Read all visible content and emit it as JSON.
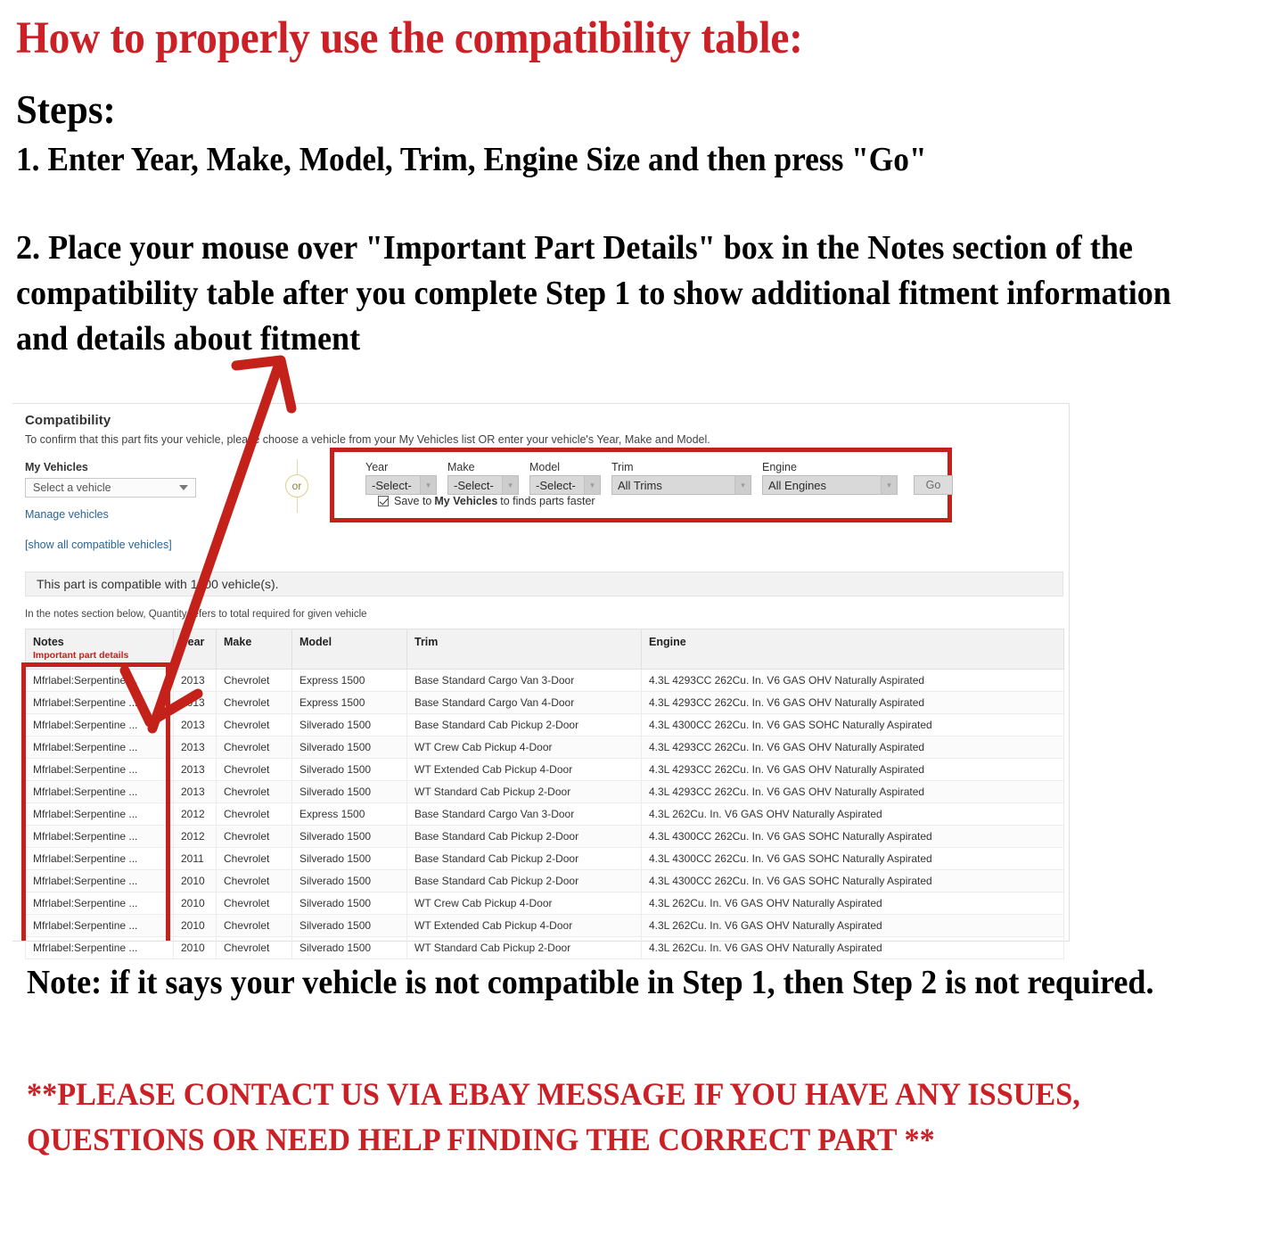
{
  "instructions": {
    "headline": "How to properly use the compatibility table:",
    "steps_label": "Steps:",
    "step1": "1. Enter Year, Make, Model, Trim, Engine Size and then press \"Go\"",
    "step2": "2. Place your mouse over \"Important Part Details\" box in the Notes section of the compatibility table after you complete Step 1 to show additional fitment information and details about fitment",
    "note": "Note: if it says your vehicle is not compatible in Step 1, then Step 2 is not required.",
    "contact": "**PLEASE CONTACT US VIA EBAY MESSAGE IF YOU HAVE ANY ISSUES, QUESTIONS OR NEED HELP FINDING THE CORRECT PART **"
  },
  "colors": {
    "accent_red": "#CC2027",
    "highlight_red": "#C5211B",
    "link_blue": "#2a6496",
    "header_gray": "#f2f2f2"
  },
  "compatibility": {
    "title": "Compatibility",
    "subtitle": "To confirm that this part fits your vehicle, please choose a vehicle from your My Vehicles list OR enter your vehicle's Year, Make and Model.",
    "my_vehicles_label": "My Vehicles",
    "my_vehicles_value": "Select a vehicle",
    "manage_vehicles_link": "Manage vehicles",
    "show_all_link": "[show all compatible vehicles]",
    "or_text": "or",
    "banner": "This part is compatible with 1000 vehicle(s).",
    "qty_note": "In the notes section below, Quantity refers to total required for given vehicle",
    "save_prefix": "Save to",
    "save_bold": "My Vehicles",
    "save_suffix": "to finds parts faster",
    "go_label": "Go",
    "fields": [
      {
        "label": "Year",
        "value": "-Select-",
        "size": "small"
      },
      {
        "label": "Make",
        "value": "-Select-",
        "size": "small"
      },
      {
        "label": "Model",
        "value": "-Select-",
        "size": "small"
      },
      {
        "label": "Trim",
        "value": "All Trims",
        "size": "med"
      },
      {
        "label": "Engine",
        "value": "All Engines",
        "size": "large"
      }
    ]
  },
  "table": {
    "headers": [
      "Notes",
      "Year",
      "Make",
      "Model",
      "Trim",
      "Engine"
    ],
    "notes_sub": "Important part details",
    "rows": [
      [
        "Mfrlabel:Serpentine ...",
        "2013",
        "Chevrolet",
        "Express 1500",
        "Base Standard Cargo Van 3-Door",
        "4.3L 4293CC 262Cu. In. V6 GAS OHV Naturally Aspirated"
      ],
      [
        "Mfrlabel:Serpentine ...",
        "2013",
        "Chevrolet",
        "Express 1500",
        "Base Standard Cargo Van 4-Door",
        "4.3L 4293CC 262Cu. In. V6 GAS OHV Naturally Aspirated"
      ],
      [
        "Mfrlabel:Serpentine ...",
        "2013",
        "Chevrolet",
        "Silverado 1500",
        "Base Standard Cab Pickup 2-Door",
        "4.3L 4300CC 262Cu. In. V6 GAS SOHC Naturally Aspirated"
      ],
      [
        "Mfrlabel:Serpentine ...",
        "2013",
        "Chevrolet",
        "Silverado 1500",
        "WT Crew Cab Pickup 4-Door",
        "4.3L 4293CC 262Cu. In. V6 GAS OHV Naturally Aspirated"
      ],
      [
        "Mfrlabel:Serpentine ...",
        "2013",
        "Chevrolet",
        "Silverado 1500",
        "WT Extended Cab Pickup 4-Door",
        "4.3L 4293CC 262Cu. In. V6 GAS OHV Naturally Aspirated"
      ],
      [
        "Mfrlabel:Serpentine ...",
        "2013",
        "Chevrolet",
        "Silverado 1500",
        "WT Standard Cab Pickup 2-Door",
        "4.3L 4293CC 262Cu. In. V6 GAS OHV Naturally Aspirated"
      ],
      [
        "Mfrlabel:Serpentine ...",
        "2012",
        "Chevrolet",
        "Express 1500",
        "Base Standard Cargo Van 3-Door",
        "4.3L 262Cu. In. V6 GAS OHV Naturally Aspirated"
      ],
      [
        "Mfrlabel:Serpentine ...",
        "2012",
        "Chevrolet",
        "Silverado 1500",
        "Base Standard Cab Pickup 2-Door",
        "4.3L 4300CC 262Cu. In. V6 GAS SOHC Naturally Aspirated"
      ],
      [
        "Mfrlabel:Serpentine ...",
        "2011",
        "Chevrolet",
        "Silverado 1500",
        "Base Standard Cab Pickup 2-Door",
        "4.3L 4300CC 262Cu. In. V6 GAS SOHC Naturally Aspirated"
      ],
      [
        "Mfrlabel:Serpentine ...",
        "2010",
        "Chevrolet",
        "Silverado 1500",
        "Base Standard Cab Pickup 2-Door",
        "4.3L 4300CC 262Cu. In. V6 GAS SOHC Naturally Aspirated"
      ],
      [
        "Mfrlabel:Serpentine ...",
        "2010",
        "Chevrolet",
        "Silverado 1500",
        "WT Crew Cab Pickup 4-Door",
        "4.3L 262Cu. In. V6 GAS OHV Naturally Aspirated"
      ],
      [
        "Mfrlabel:Serpentine ...",
        "2010",
        "Chevrolet",
        "Silverado 1500",
        "WT Extended Cab Pickup 4-Door",
        "4.3L 262Cu. In. V6 GAS OHV Naturally Aspirated"
      ],
      [
        "Mfrlabel:Serpentine ...",
        "2010",
        "Chevrolet",
        "Silverado 1500",
        "WT Standard Cab Pickup 2-Door",
        "4.3L 262Cu. In. V6 GAS OHV Naturally Aspirated"
      ]
    ]
  }
}
